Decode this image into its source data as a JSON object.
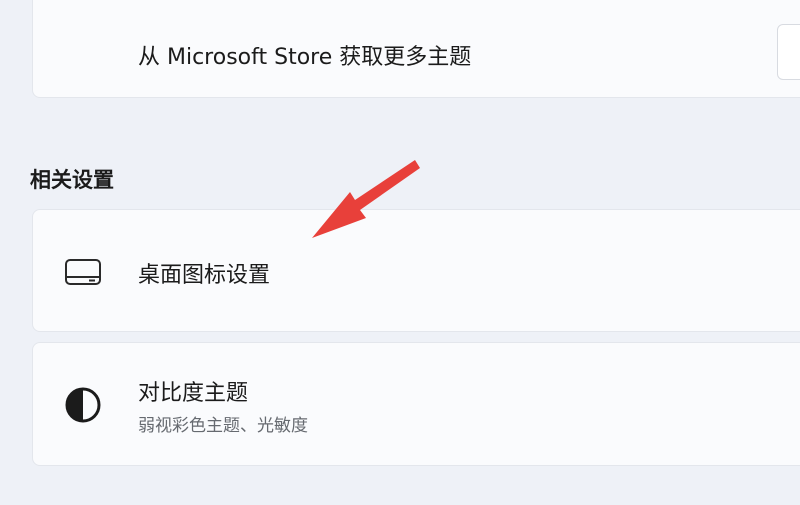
{
  "store": {
    "label": "从 Microsoft Store 获取更多主题"
  },
  "related": {
    "title": "相关设置",
    "items": [
      {
        "label": "桌面图标设置",
        "icon": "desktop-icon"
      },
      {
        "label": "对比度主题",
        "sublabel": "弱视彩色主题、光敏度",
        "icon": "contrast-icon"
      }
    ]
  },
  "annotation": {
    "arrow_color": "#e8403a"
  }
}
